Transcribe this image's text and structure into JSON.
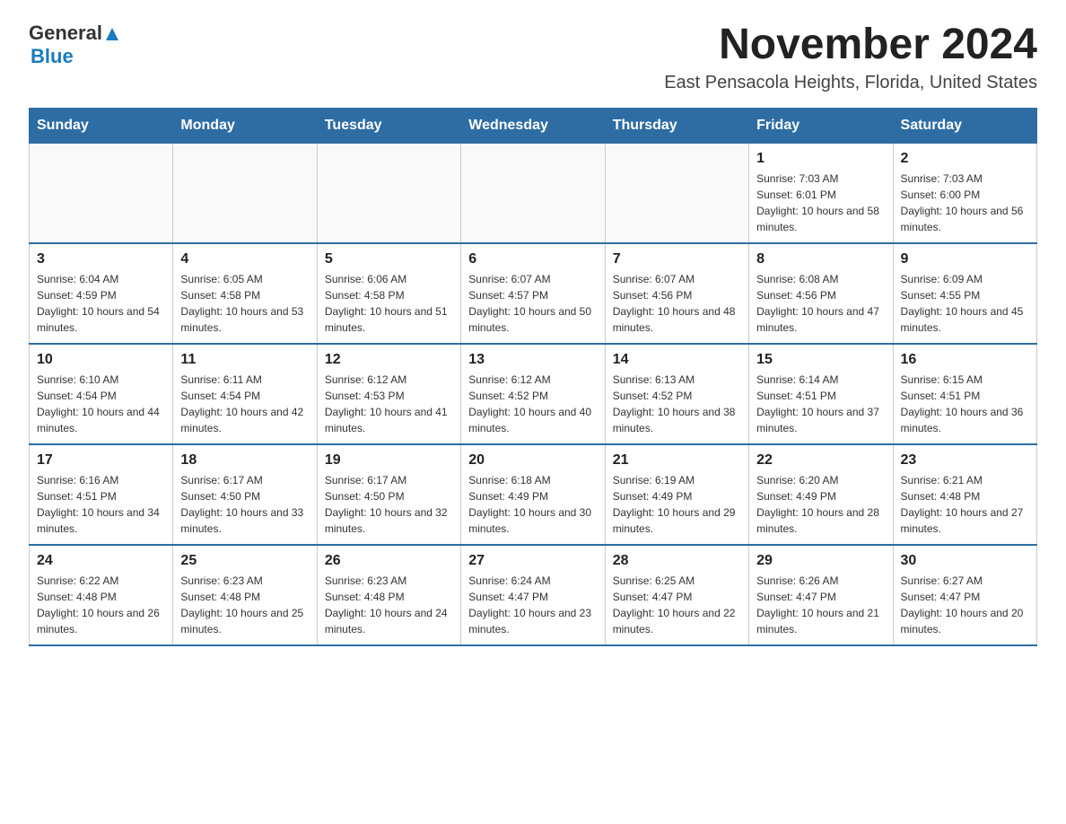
{
  "header": {
    "logo_general": "General",
    "logo_blue": "Blue",
    "title": "November 2024",
    "subtitle": "East Pensacola Heights, Florida, United States"
  },
  "calendar": {
    "days_of_week": [
      "Sunday",
      "Monday",
      "Tuesday",
      "Wednesday",
      "Thursday",
      "Friday",
      "Saturday"
    ],
    "weeks": [
      [
        {
          "day": "",
          "info": ""
        },
        {
          "day": "",
          "info": ""
        },
        {
          "day": "",
          "info": ""
        },
        {
          "day": "",
          "info": ""
        },
        {
          "day": "",
          "info": ""
        },
        {
          "day": "1",
          "info": "Sunrise: 7:03 AM\nSunset: 6:01 PM\nDaylight: 10 hours and 58 minutes."
        },
        {
          "day": "2",
          "info": "Sunrise: 7:03 AM\nSunset: 6:00 PM\nDaylight: 10 hours and 56 minutes."
        }
      ],
      [
        {
          "day": "3",
          "info": "Sunrise: 6:04 AM\nSunset: 4:59 PM\nDaylight: 10 hours and 54 minutes."
        },
        {
          "day": "4",
          "info": "Sunrise: 6:05 AM\nSunset: 4:58 PM\nDaylight: 10 hours and 53 minutes."
        },
        {
          "day": "5",
          "info": "Sunrise: 6:06 AM\nSunset: 4:58 PM\nDaylight: 10 hours and 51 minutes."
        },
        {
          "day": "6",
          "info": "Sunrise: 6:07 AM\nSunset: 4:57 PM\nDaylight: 10 hours and 50 minutes."
        },
        {
          "day": "7",
          "info": "Sunrise: 6:07 AM\nSunset: 4:56 PM\nDaylight: 10 hours and 48 minutes."
        },
        {
          "day": "8",
          "info": "Sunrise: 6:08 AM\nSunset: 4:56 PM\nDaylight: 10 hours and 47 minutes."
        },
        {
          "day": "9",
          "info": "Sunrise: 6:09 AM\nSunset: 4:55 PM\nDaylight: 10 hours and 45 minutes."
        }
      ],
      [
        {
          "day": "10",
          "info": "Sunrise: 6:10 AM\nSunset: 4:54 PM\nDaylight: 10 hours and 44 minutes."
        },
        {
          "day": "11",
          "info": "Sunrise: 6:11 AM\nSunset: 4:54 PM\nDaylight: 10 hours and 42 minutes."
        },
        {
          "day": "12",
          "info": "Sunrise: 6:12 AM\nSunset: 4:53 PM\nDaylight: 10 hours and 41 minutes."
        },
        {
          "day": "13",
          "info": "Sunrise: 6:12 AM\nSunset: 4:52 PM\nDaylight: 10 hours and 40 minutes."
        },
        {
          "day": "14",
          "info": "Sunrise: 6:13 AM\nSunset: 4:52 PM\nDaylight: 10 hours and 38 minutes."
        },
        {
          "day": "15",
          "info": "Sunrise: 6:14 AM\nSunset: 4:51 PM\nDaylight: 10 hours and 37 minutes."
        },
        {
          "day": "16",
          "info": "Sunrise: 6:15 AM\nSunset: 4:51 PM\nDaylight: 10 hours and 36 minutes."
        }
      ],
      [
        {
          "day": "17",
          "info": "Sunrise: 6:16 AM\nSunset: 4:51 PM\nDaylight: 10 hours and 34 minutes."
        },
        {
          "day": "18",
          "info": "Sunrise: 6:17 AM\nSunset: 4:50 PM\nDaylight: 10 hours and 33 minutes."
        },
        {
          "day": "19",
          "info": "Sunrise: 6:17 AM\nSunset: 4:50 PM\nDaylight: 10 hours and 32 minutes."
        },
        {
          "day": "20",
          "info": "Sunrise: 6:18 AM\nSunset: 4:49 PM\nDaylight: 10 hours and 30 minutes."
        },
        {
          "day": "21",
          "info": "Sunrise: 6:19 AM\nSunset: 4:49 PM\nDaylight: 10 hours and 29 minutes."
        },
        {
          "day": "22",
          "info": "Sunrise: 6:20 AM\nSunset: 4:49 PM\nDaylight: 10 hours and 28 minutes."
        },
        {
          "day": "23",
          "info": "Sunrise: 6:21 AM\nSunset: 4:48 PM\nDaylight: 10 hours and 27 minutes."
        }
      ],
      [
        {
          "day": "24",
          "info": "Sunrise: 6:22 AM\nSunset: 4:48 PM\nDaylight: 10 hours and 26 minutes."
        },
        {
          "day": "25",
          "info": "Sunrise: 6:23 AM\nSunset: 4:48 PM\nDaylight: 10 hours and 25 minutes."
        },
        {
          "day": "26",
          "info": "Sunrise: 6:23 AM\nSunset: 4:48 PM\nDaylight: 10 hours and 24 minutes."
        },
        {
          "day": "27",
          "info": "Sunrise: 6:24 AM\nSunset: 4:47 PM\nDaylight: 10 hours and 23 minutes."
        },
        {
          "day": "28",
          "info": "Sunrise: 6:25 AM\nSunset: 4:47 PM\nDaylight: 10 hours and 22 minutes."
        },
        {
          "day": "29",
          "info": "Sunrise: 6:26 AM\nSunset: 4:47 PM\nDaylight: 10 hours and 21 minutes."
        },
        {
          "day": "30",
          "info": "Sunrise: 6:27 AM\nSunset: 4:47 PM\nDaylight: 10 hours and 20 minutes."
        }
      ]
    ]
  }
}
